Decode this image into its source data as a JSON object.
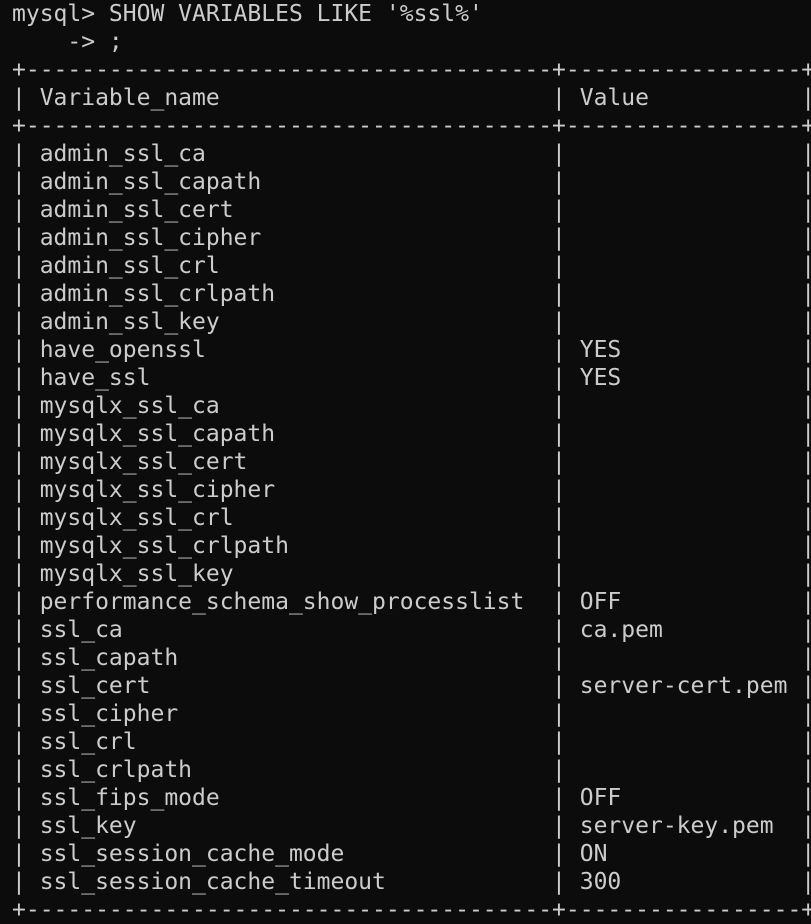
{
  "prompt": {
    "line1": "mysql> SHOW VARIABLES LIKE '%ssl%'",
    "line2": "    -> ;"
  },
  "table": {
    "border": "+--------------------------------------+-----------------+",
    "header": "| Variable_name                        | Value           |",
    "rows": [
      "| admin_ssl_ca                         |                 |",
      "| admin_ssl_capath                     |                 |",
      "| admin_ssl_cert                       |                 |",
      "| admin_ssl_cipher                     |                 |",
      "| admin_ssl_crl                        |                 |",
      "| admin_ssl_crlpath                    |                 |",
      "| admin_ssl_key                        |                 |",
      "| have_openssl                         | YES             |",
      "| have_ssl                             | YES             |",
      "| mysqlx_ssl_ca                        |                 |",
      "| mysqlx_ssl_capath                    |                 |",
      "| mysqlx_ssl_cert                      |                 |",
      "| mysqlx_ssl_cipher                    |                 |",
      "| mysqlx_ssl_crl                       |                 |",
      "| mysqlx_ssl_crlpath                   |                 |",
      "| mysqlx_ssl_key                       |                 |",
      "| performance_schema_show_processlist  | OFF             |",
      "| ssl_ca                               | ca.pem          |",
      "| ssl_capath                           |                 |",
      "| ssl_cert                             | server-cert.pem |",
      "| ssl_cipher                           |                 |",
      "| ssl_crl                              |                 |",
      "| ssl_crlpath                          |                 |",
      "| ssl_fips_mode                        | OFF             |",
      "| ssl_key                              | server-key.pem  |",
      "| ssl_session_cache_mode               | ON              |",
      "| ssl_session_cache_timeout            | 300             |"
    ]
  },
  "colors": {
    "background": "#0c0c0c",
    "text": "#cccccc"
  }
}
